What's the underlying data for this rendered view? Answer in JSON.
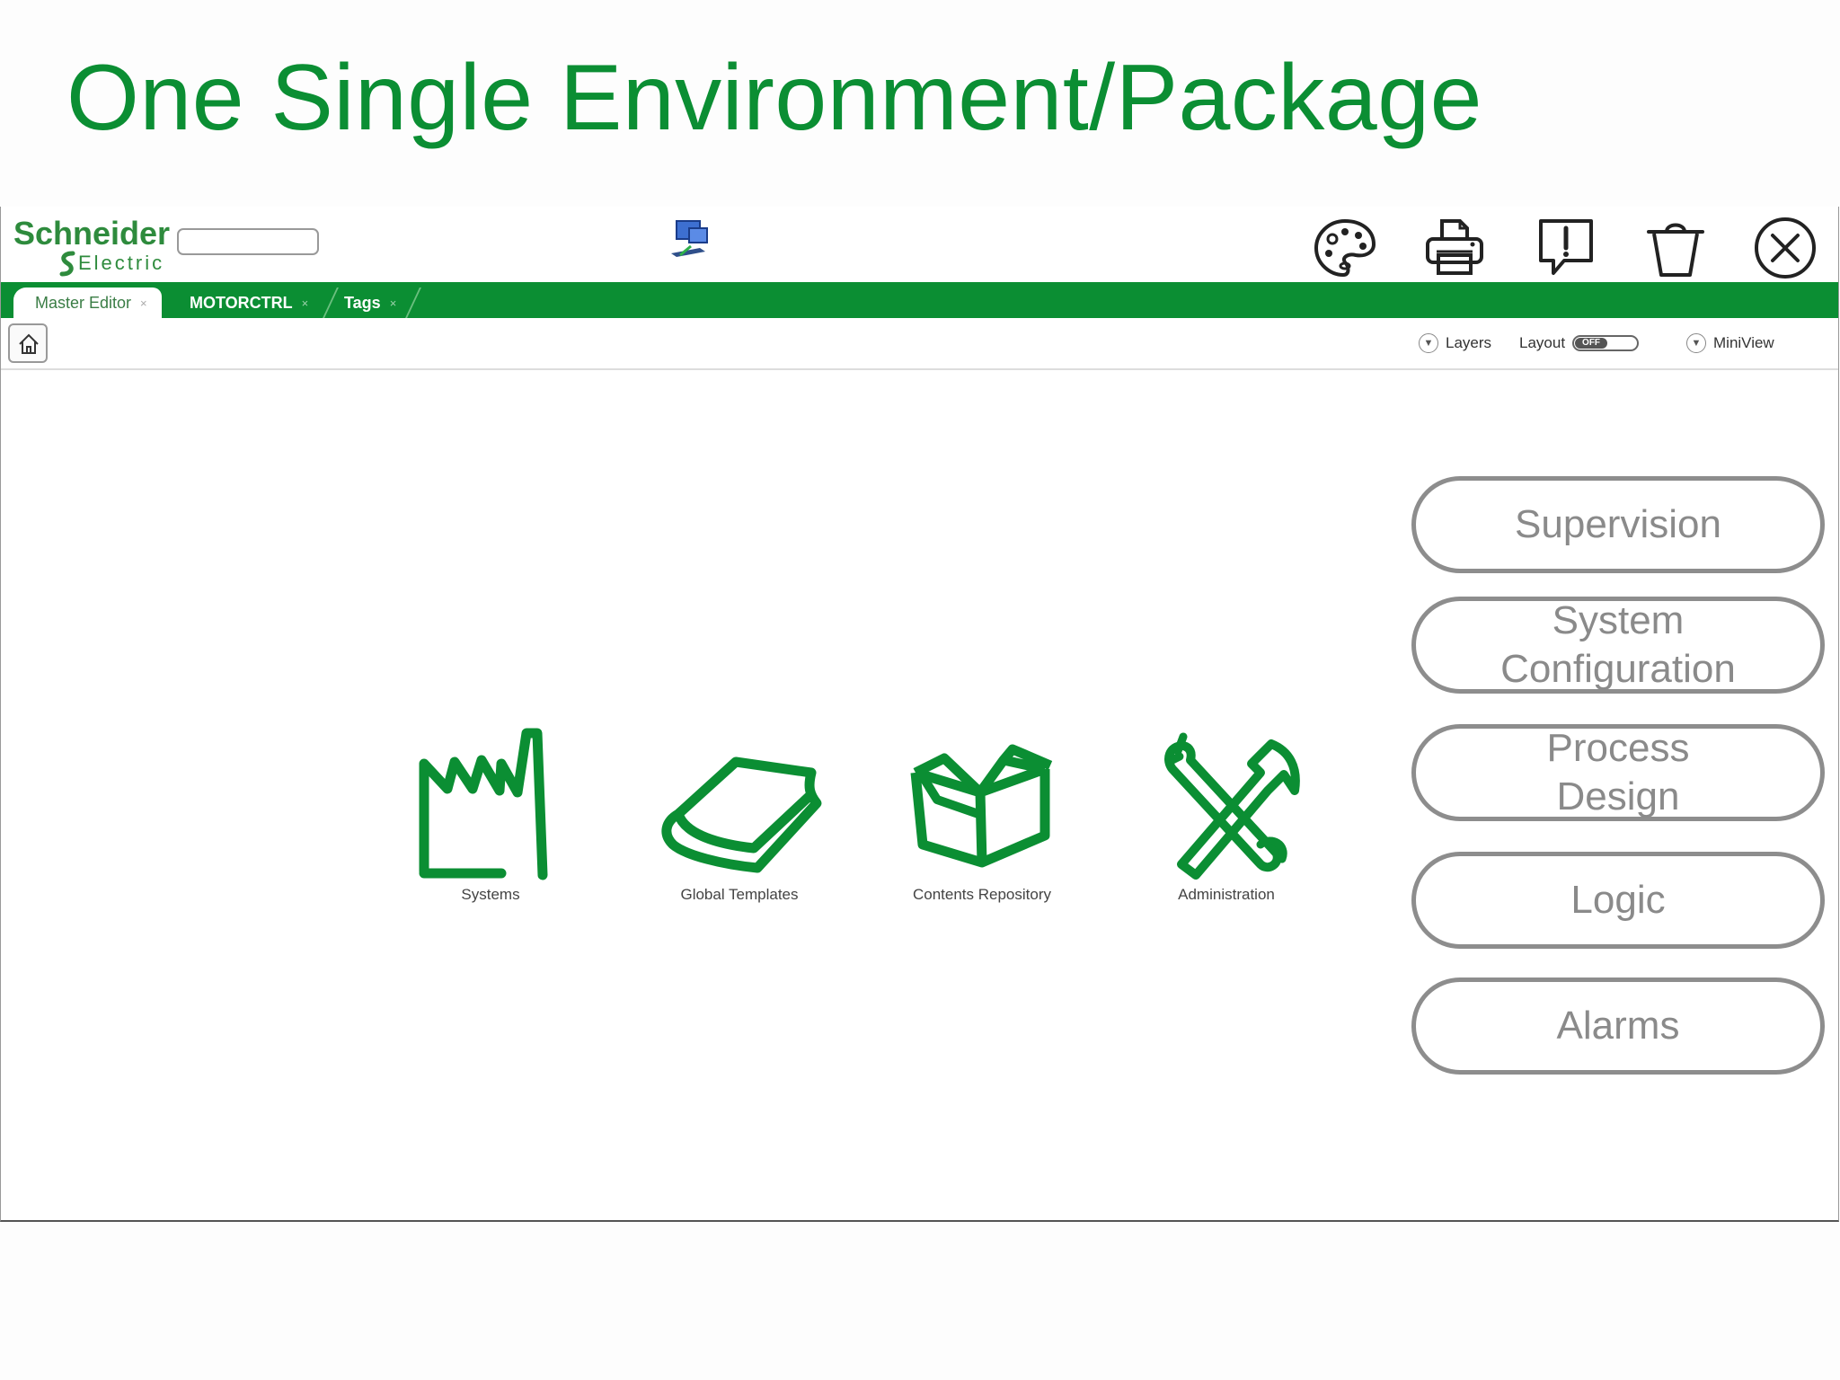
{
  "slide": {
    "title": "One Single Environment/Package"
  },
  "header": {
    "logo": {
      "name": "Schneider",
      "sub": "Electric"
    },
    "icons": [
      "palette-icon",
      "printer-icon",
      "alert-icon",
      "trash-icon",
      "close-icon"
    ]
  },
  "tabs": [
    {
      "label": "Master Editor",
      "close": "×",
      "active": true
    },
    {
      "label": "MOTORCTRL",
      "close": "×",
      "active": false
    },
    {
      "label": "Tags",
      "close": "×",
      "active": false
    }
  ],
  "toolbar": {
    "layers_label": "Layers",
    "layout_label": "Layout",
    "layout_state": "OFF",
    "miniview_label": "MiniView"
  },
  "tiles": [
    {
      "label": "Systems",
      "icon": "factory-icon"
    },
    {
      "label": "Global Templates",
      "icon": "book-icon"
    },
    {
      "label": "Contents Repository",
      "icon": "box-icon"
    },
    {
      "label": "Administration",
      "icon": "tools-icon"
    }
  ],
  "side_buttons": [
    {
      "line1": "Supervision",
      "line2": ""
    },
    {
      "line1": "System",
      "line2": "Configuration"
    },
    {
      "line1": "Process",
      "line2": "Design"
    },
    {
      "line1": "Logic",
      "line2": ""
    },
    {
      "line1": "Alarms",
      "line2": ""
    }
  ],
  "colors": {
    "brand_green": "#0b8e33",
    "button_border": "#8d8d8d",
    "button_text": "#8a8a8a"
  }
}
